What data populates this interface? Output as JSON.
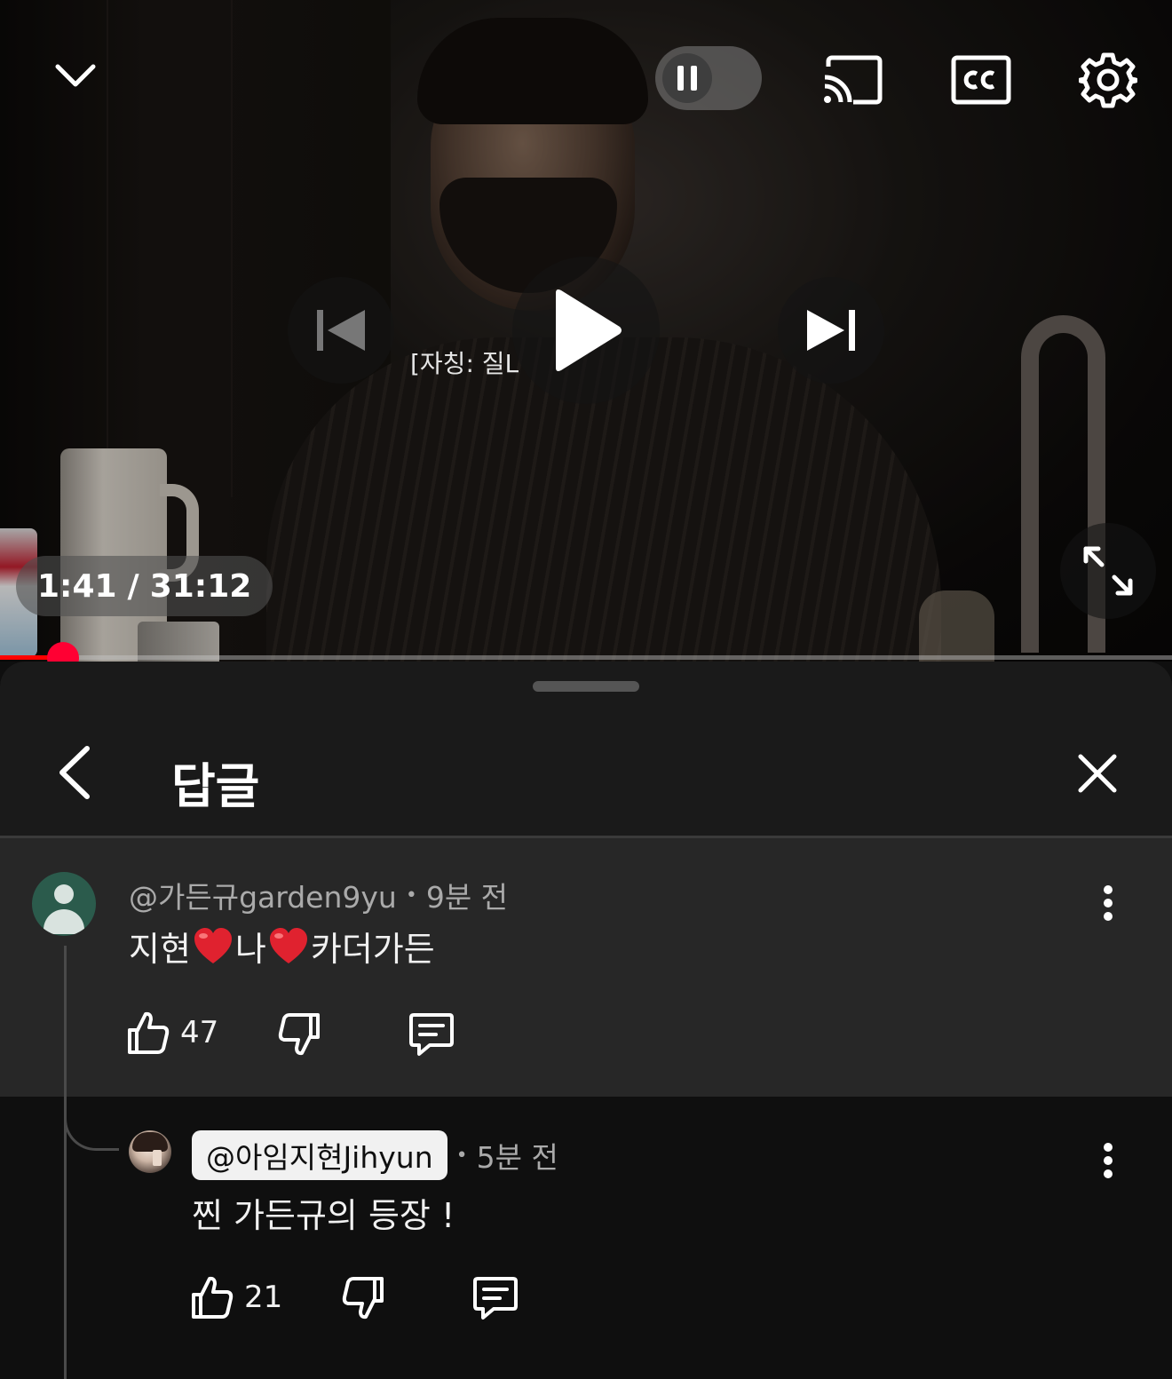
{
  "player": {
    "subtitle_text": "[자칭: 질L",
    "time_current": "1:41",
    "time_separator": "/",
    "time_total": "31:12",
    "progress_fraction": 0.054,
    "accent_color": "#ff0000",
    "icons": {
      "collapse": "chevron-down-icon",
      "pause": "pause-icon",
      "cast": "cast-icon",
      "captions": "cc-icon",
      "settings": "gear-icon",
      "previous": "skip-previous-icon",
      "play": "play-icon",
      "next": "skip-next-icon",
      "fullscreen": "fullscreen-icon"
    }
  },
  "panel": {
    "title": "답글",
    "icons": {
      "back": "chevron-left-icon",
      "close": "close-icon"
    }
  },
  "comments": [
    {
      "author": "@가든규garden9yu",
      "separator": "•",
      "time": "9분 전",
      "text_parts": [
        "지현",
        "나",
        "카더가든"
      ],
      "emoji": "heart",
      "likes": "47"
    },
    {
      "author": "@아임지현Jihyun",
      "separator": "•",
      "time": "5분 전",
      "text": "찐 가든규의 등장 !",
      "likes": "21"
    }
  ]
}
